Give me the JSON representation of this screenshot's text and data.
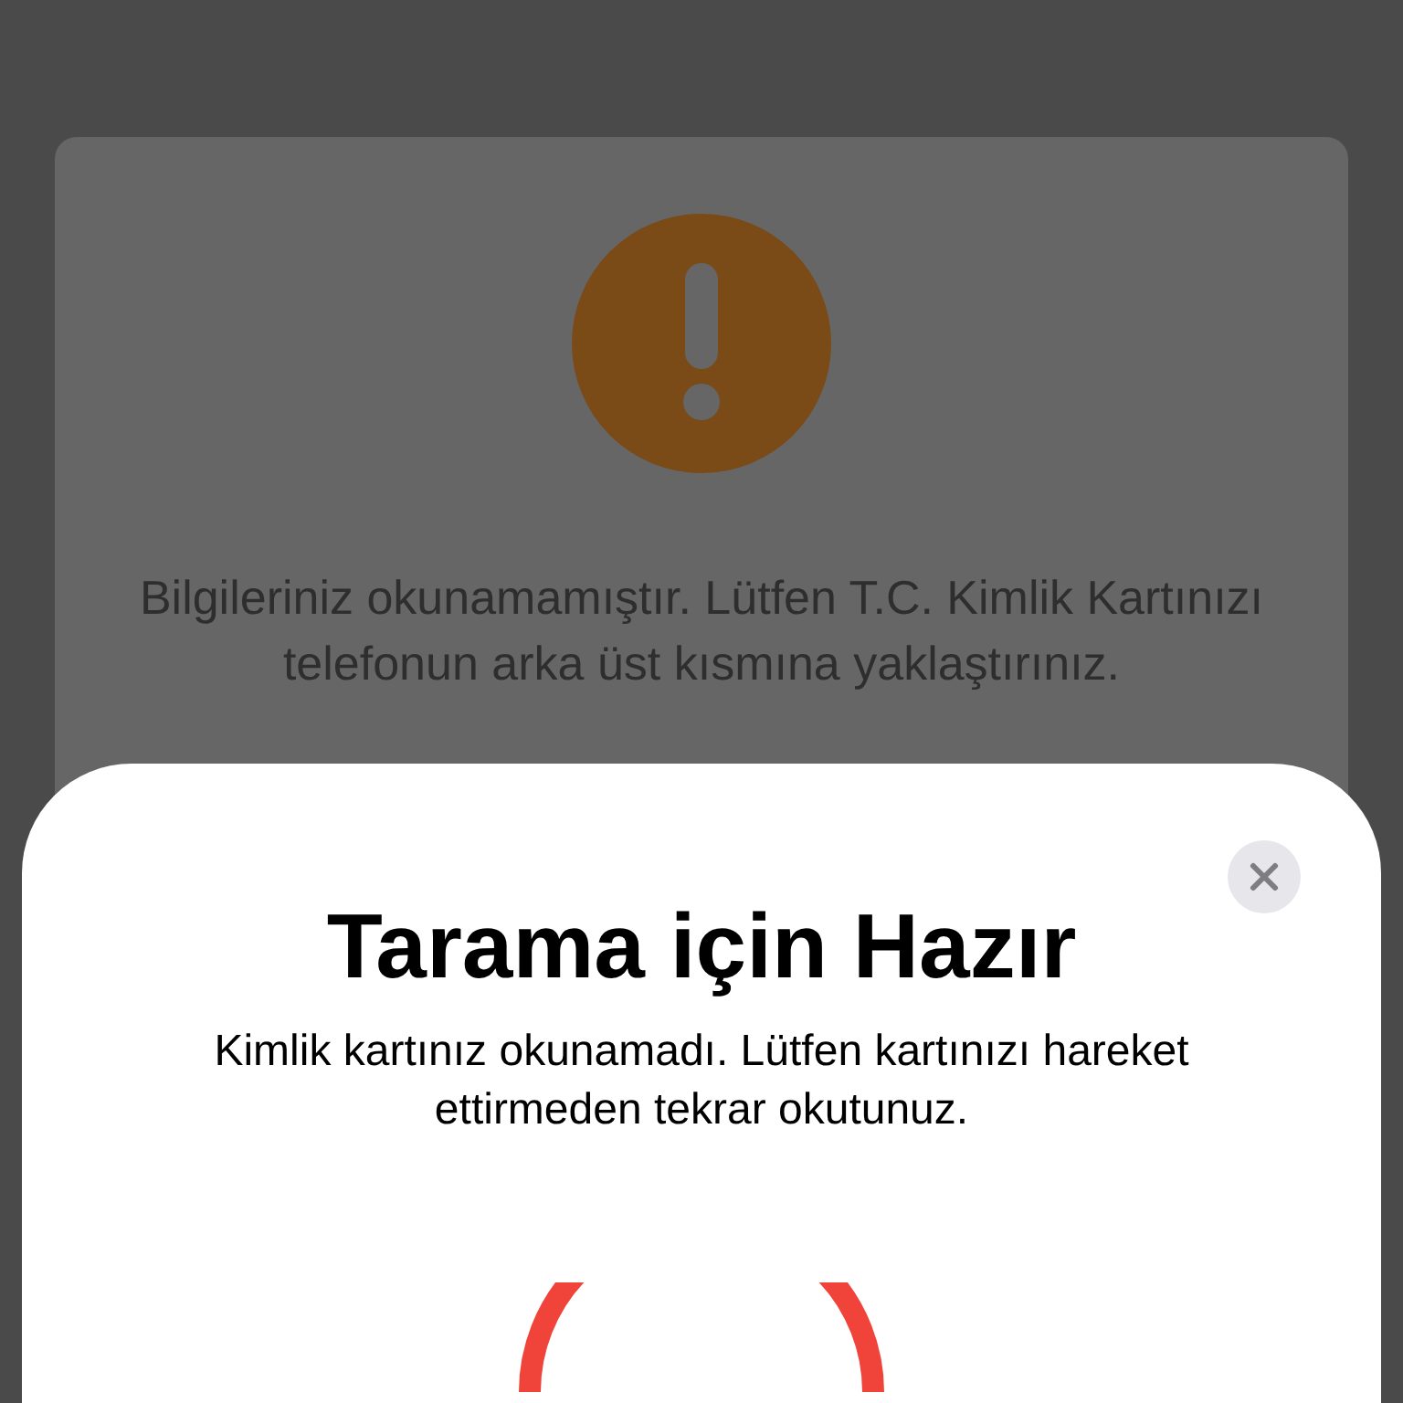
{
  "alert": {
    "message": "Bilgileriniz okunamamıştır. Lütfen T.C. Kimlik Kartınızı telefonun arka üst kısmına yaklaştırınız."
  },
  "scan_sheet": {
    "title": "Tarama için Hazır",
    "message": "Kimlik kartınız okunamadı. Lütfen kartınızı hareket ettirmeden tekrar okutunuz."
  }
}
